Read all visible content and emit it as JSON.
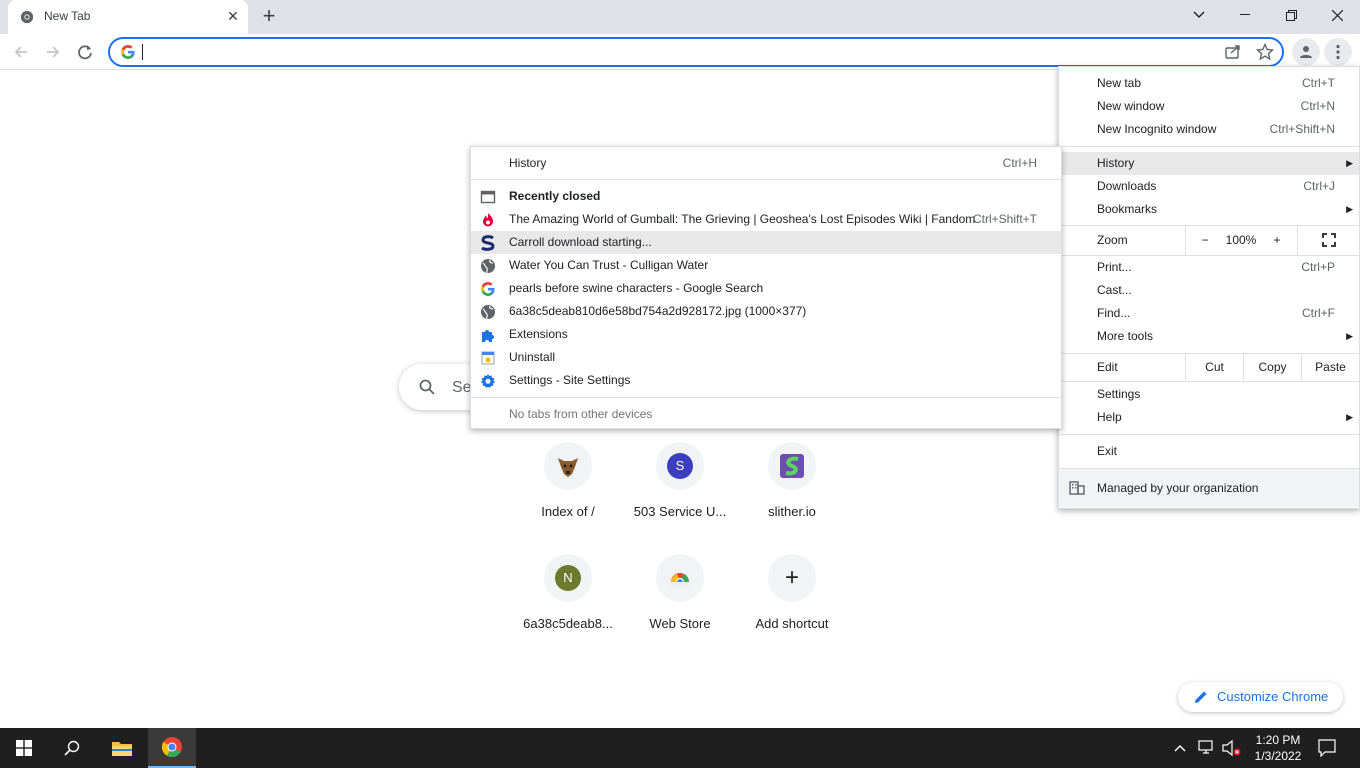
{
  "tab": {
    "title": "New Tab",
    "close": "✕"
  },
  "window": {
    "new_tab": "+",
    "tab_search": "⌄",
    "minimize": "—",
    "maximize": "❐",
    "close": "✕"
  },
  "omnibox": {
    "value": "",
    "placeholder": ""
  },
  "ntp": {
    "search_placeholder": "Se",
    "shortcuts": [
      {
        "label": "Index of /",
        "letter": ""
      },
      {
        "label": "503 Service U...",
        "letter": "S",
        "color": "#3d3dbf"
      },
      {
        "label": "slither.io",
        "letter": ""
      },
      {
        "label": "6a38c5deab8...",
        "letter": "N",
        "color": "#6d7a2e"
      },
      {
        "label": "Web Store",
        "letter": ""
      },
      {
        "label": "Add shortcut",
        "letter": "+"
      }
    ],
    "customize_label": "Customize Chrome"
  },
  "chrome_menu": {
    "new_tab": {
      "label": "New tab",
      "shortcut": "Ctrl+T"
    },
    "new_window": {
      "label": "New window",
      "shortcut": "Ctrl+N"
    },
    "new_incognito": {
      "label": "New Incognito window",
      "shortcut": "Ctrl+Shift+N"
    },
    "history": {
      "label": "History"
    },
    "downloads": {
      "label": "Downloads",
      "shortcut": "Ctrl+J"
    },
    "bookmarks": {
      "label": "Bookmarks"
    },
    "zoom": {
      "label": "Zoom",
      "minus": "−",
      "value": "100%",
      "plus": "+"
    },
    "print": {
      "label": "Print...",
      "shortcut": "Ctrl+P"
    },
    "cast": {
      "label": "Cast..."
    },
    "find": {
      "label": "Find...",
      "shortcut": "Ctrl+F"
    },
    "more_tools": {
      "label": "More tools"
    },
    "edit": {
      "label": "Edit",
      "cut": "Cut",
      "copy": "Copy",
      "paste": "Paste"
    },
    "settings": {
      "label": "Settings"
    },
    "help": {
      "label": "Help"
    },
    "exit": {
      "label": "Exit"
    },
    "managed": {
      "label": "Managed by your organization"
    }
  },
  "history_menu": {
    "history": {
      "label": "History",
      "shortcut": "Ctrl+H"
    },
    "recently_closed": "Recently closed",
    "items": [
      {
        "label": "The Amazing World of Gumball: The Grieving | Geoshea's Lost Episodes Wiki | Fandom",
        "shortcut": "Ctrl+Shift+T",
        "icon": "fandom-icon"
      },
      {
        "label": "Carroll download starting...",
        "shortcut": "",
        "icon": "s-logo-icon"
      },
      {
        "label": "Water You Can Trust - Culligan Water",
        "shortcut": "",
        "icon": "globe-icon"
      },
      {
        "label": "pearls before swine characters - Google Search",
        "shortcut": "",
        "icon": "google-icon"
      },
      {
        "label": "6a38c5deab810d6e58bd754a2d928172.jpg (1000×377)",
        "shortcut": "",
        "icon": "globe-icon"
      },
      {
        "label": "Extensions",
        "shortcut": "",
        "icon": "puzzle-icon"
      },
      {
        "label": "Uninstall",
        "shortcut": "",
        "icon": "uninstall-icon"
      },
      {
        "label": "Settings - Site Settings",
        "shortcut": "",
        "icon": "gear-icon"
      }
    ],
    "no_tabs": "No tabs from other devices"
  },
  "taskbar": {
    "time": "1:20 PM",
    "date": "1/3/2022"
  }
}
